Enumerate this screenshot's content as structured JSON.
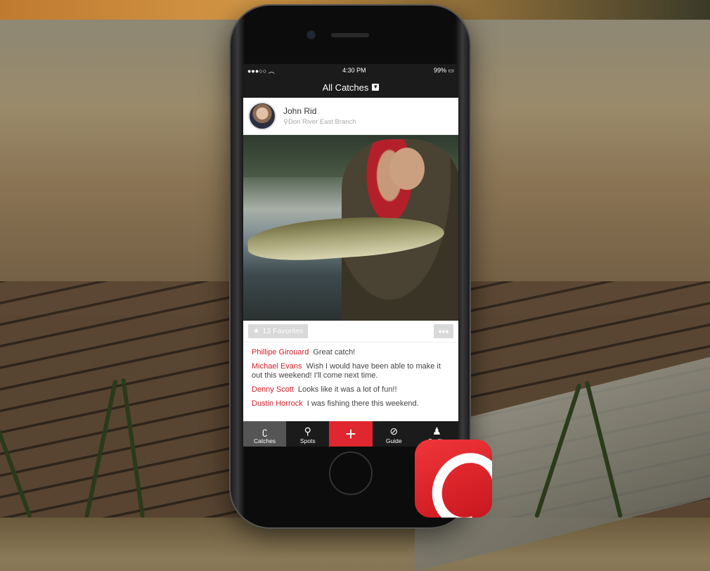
{
  "status": {
    "time": "4:30 PM",
    "battery": "99%"
  },
  "header": {
    "title": "All Catches"
  },
  "post": {
    "user": "John Rid",
    "location": "Don River East Branch",
    "favorites": "13 Favorites",
    "more": "•••"
  },
  "comments": [
    {
      "author": "Phillipe Girouard",
      "text": "Great catch!"
    },
    {
      "author": "Michael Evans",
      "text": "Wish I would have been able to make it out this weekend! I'll come next time."
    },
    {
      "author": "Denny Scott",
      "text": "Looks like it was a lot of fun!!"
    },
    {
      "author": "Dustin Horrock",
      "text": "I was fishing there this weekend."
    }
  ],
  "tabs": [
    {
      "label": "Catches",
      "icon": "hook-icon"
    },
    {
      "label": "Spots",
      "icon": "map-pin-icon"
    },
    {
      "label": "",
      "icon": "plus-icon"
    },
    {
      "label": "Guide",
      "icon": "compass-icon"
    },
    {
      "label": "Profile",
      "icon": "profile-icon"
    }
  ],
  "colors": {
    "accent": "#e0262e",
    "bar": "#1b1b1b"
  }
}
